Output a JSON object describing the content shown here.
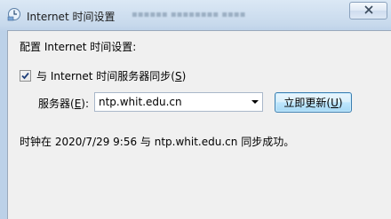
{
  "window": {
    "title": "Internet 时间设置"
  },
  "main": {
    "heading": "配置 Internet 时间设置:",
    "sync_checkbox": {
      "label_prefix": "与 Internet 时间服务器同步(",
      "accel": "S",
      "label_suffix": ")",
      "checked": true
    },
    "server": {
      "label_prefix": "服务器(",
      "accel": "E",
      "label_suffix": "):",
      "value": "ntp.whit.edu.cn"
    },
    "update_button": {
      "label_prefix": "立即更新(",
      "accel": "U",
      "label_suffix": ")"
    },
    "status": "时钟在 2020/7/29 9:56 与 ntp.whit.edu.cn 同步成功。"
  },
  "icons": {
    "window_icon": "clock-globe-icon",
    "close": "close-icon",
    "dropdown": "chevron-down-icon",
    "checkmark": "checkmark-icon"
  },
  "colors": {
    "titlebar": "#c7d9ec",
    "content_bg": "#f0f0f0",
    "button_border": "#3c7fb1"
  }
}
